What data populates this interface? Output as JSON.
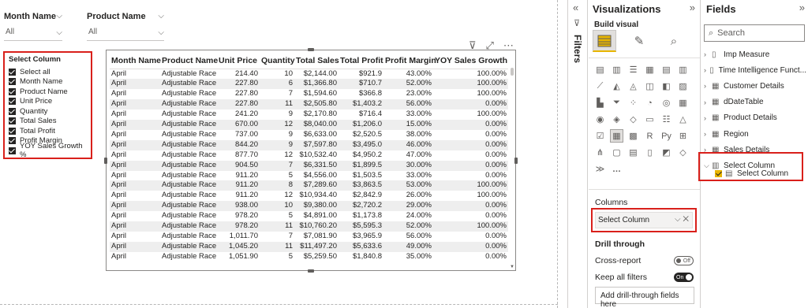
{
  "slicers": [
    {
      "title": "Month Name",
      "value": "All"
    },
    {
      "title": "Product Name",
      "value": "All"
    }
  ],
  "select_column_slicer": {
    "title": "Select Column",
    "options": [
      "Select all",
      "Month Name",
      "Product Name",
      "Unit Price",
      "Quantity",
      "Total Sales",
      "Total Profit",
      "Profit Margin",
      "YOY Sales Growth %"
    ]
  },
  "table": {
    "headers": [
      "Month Name",
      "Product Name",
      "Unit Price",
      "Quantity",
      "Total Sales",
      "Total Profit",
      "Profit Margin",
      "YOY Sales Growth %"
    ],
    "rows": [
      [
        "April",
        "Adjustable Race",
        "214.40",
        "10",
        "$2,144.00",
        "$921.9",
        "43.00%",
        "100.00%"
      ],
      [
        "April",
        "Adjustable Race",
        "227.80",
        "6",
        "$1,366.80",
        "$710.7",
        "52.00%",
        "100.00%"
      ],
      [
        "April",
        "Adjustable Race",
        "227.80",
        "7",
        "$1,594.60",
        "$366.8",
        "23.00%",
        "100.00%"
      ],
      [
        "April",
        "Adjustable Race",
        "227.80",
        "11",
        "$2,505.80",
        "$1,403.2",
        "56.00%",
        "0.00%"
      ],
      [
        "April",
        "Adjustable Race",
        "241.20",
        "9",
        "$2,170.80",
        "$716.4",
        "33.00%",
        "100.00%"
      ],
      [
        "April",
        "Adjustable Race",
        "670.00",
        "12",
        "$8,040.00",
        "$1,206.0",
        "15.00%",
        "0.00%"
      ],
      [
        "April",
        "Adjustable Race",
        "737.00",
        "9",
        "$6,633.00",
        "$2,520.5",
        "38.00%",
        "0.00%"
      ],
      [
        "April",
        "Adjustable Race",
        "844.20",
        "9",
        "$7,597.80",
        "$3,495.0",
        "46.00%",
        "0.00%"
      ],
      [
        "April",
        "Adjustable Race",
        "877.70",
        "12",
        "$10,532.40",
        "$4,950.2",
        "47.00%",
        "0.00%"
      ],
      [
        "April",
        "Adjustable Race",
        "904.50",
        "7",
        "$6,331.50",
        "$1,899.5",
        "30.00%",
        "0.00%"
      ],
      [
        "April",
        "Adjustable Race",
        "911.20",
        "5",
        "$4,556.00",
        "$1,503.5",
        "33.00%",
        "0.00%"
      ],
      [
        "April",
        "Adjustable Race",
        "911.20",
        "8",
        "$7,289.60",
        "$3,863.5",
        "53.00%",
        "100.00%"
      ],
      [
        "April",
        "Adjustable Race",
        "911.20",
        "12",
        "$10,934.40",
        "$2,842.9",
        "26.00%",
        "100.00%"
      ],
      [
        "April",
        "Adjustable Race",
        "938.00",
        "10",
        "$9,380.00",
        "$2,720.2",
        "29.00%",
        "0.00%"
      ],
      [
        "April",
        "Adjustable Race",
        "978.20",
        "5",
        "$4,891.00",
        "$1,173.8",
        "24.00%",
        "0.00%"
      ],
      [
        "April",
        "Adjustable Race",
        "978.20",
        "11",
        "$10,760.20",
        "$5,595.3",
        "52.00%",
        "100.00%"
      ],
      [
        "April",
        "Adjustable Race",
        "1,011.70",
        "7",
        "$7,081.90",
        "$3,965.9",
        "56.00%",
        "0.00%"
      ],
      [
        "April",
        "Adjustable Race",
        "1,045.20",
        "11",
        "$11,497.20",
        "$5,633.6",
        "49.00%",
        "0.00%"
      ],
      [
        "April",
        "Adjustable Race",
        "1,051.90",
        "5",
        "$5,259.50",
        "$1,840.8",
        "35.00%",
        "0.00%"
      ]
    ]
  },
  "filters_pane": {
    "label": "Filters"
  },
  "visualizations": {
    "title": "Visualizations",
    "build_visual": "Build visual",
    "columns_label": "Columns",
    "column_field": "Select Column",
    "drill_through": "Drill through",
    "cross_report": "Cross-report",
    "cross_report_state": "Off",
    "keep_all_filters": "Keep all filters",
    "keep_all_filters_state": "On",
    "drop_hint": "Add drill-through fields here"
  },
  "fields": {
    "title": "Fields",
    "search_placeholder": "Search",
    "tables": [
      {
        "name": "Imp Measure",
        "icon": "measure-table-icon"
      },
      {
        "name": "Time Intelligence Funct...",
        "icon": "measure-table-icon"
      },
      {
        "name": "Customer Details",
        "icon": "table-icon"
      },
      {
        "name": "dDateTable",
        "icon": "table-icon"
      },
      {
        "name": "Product Details",
        "icon": "table-icon"
      },
      {
        "name": "Region",
        "icon": "table-icon"
      },
      {
        "name": "Sales Details",
        "icon": "table-icon"
      },
      {
        "name": "Select Column",
        "icon": "field-parameter-icon"
      }
    ],
    "expanded_field": "Select Column"
  },
  "colors": {
    "highlight_red": "#d9201b",
    "accent_yellow": "#e8b500"
  }
}
